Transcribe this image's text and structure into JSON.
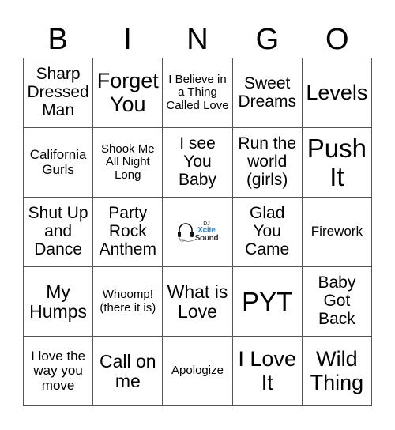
{
  "header": {
    "letters": [
      "B",
      "I",
      "N",
      "G",
      "O"
    ]
  },
  "cells": [
    {
      "text": "Sharp Dressed Man",
      "size": "s-ml"
    },
    {
      "text": "Forget You",
      "size": "s-lg"
    },
    {
      "text": "I Believe in a Thing Called Love",
      "size": "s-xxs"
    },
    {
      "text": "Sweet Dreams",
      "size": "s-ml"
    },
    {
      "text": "Levels",
      "size": "s-lg"
    },
    {
      "text": "California Gurls",
      "size": "s-xs"
    },
    {
      "text": "Shook Me All Night Long",
      "size": "s-xxs"
    },
    {
      "text": "I see You Baby",
      "size": "s-ml"
    },
    {
      "text": "Run the world (girls)",
      "size": "s-ml"
    },
    {
      "text": "Push It",
      "size": "s-xl"
    },
    {
      "text": "Shut Up and Dance",
      "size": "s-ml"
    },
    {
      "text": "Party Rock Anthem",
      "size": "s-ml"
    },
    {
      "text": "",
      "size": "s-md",
      "free": true
    },
    {
      "text": "Glad You Came",
      "size": "s-ml"
    },
    {
      "text": "Firework",
      "size": "s-xs"
    },
    {
      "text": "My Humps",
      "size": "s-md"
    },
    {
      "text": "Whoomp! (there it is)",
      "size": "s-xxs"
    },
    {
      "text": "What is Love",
      "size": "s-md"
    },
    {
      "text": "PYT",
      "size": "s-xl"
    },
    {
      "text": "Baby Got Back",
      "size": "s-ml"
    },
    {
      "text": "I love the way you move",
      "size": "s-xs"
    },
    {
      "text": "Call on me",
      "size": "s-md"
    },
    {
      "text": "Apologize",
      "size": "s-xxs"
    },
    {
      "text": "I Love It",
      "size": "s-lg"
    },
    {
      "text": "Wild Thing",
      "size": "s-lg"
    }
  ],
  "free_space": {
    "logo_prefix": "DJ",
    "logo_brand_a": "Xcite",
    "logo_brand_b": "Sound",
    "icon": "headphones-icon",
    "brand_color": "#1e88e5"
  },
  "colors": {
    "grid_line": "#555555",
    "text": "#000000",
    "background": "#ffffff"
  }
}
